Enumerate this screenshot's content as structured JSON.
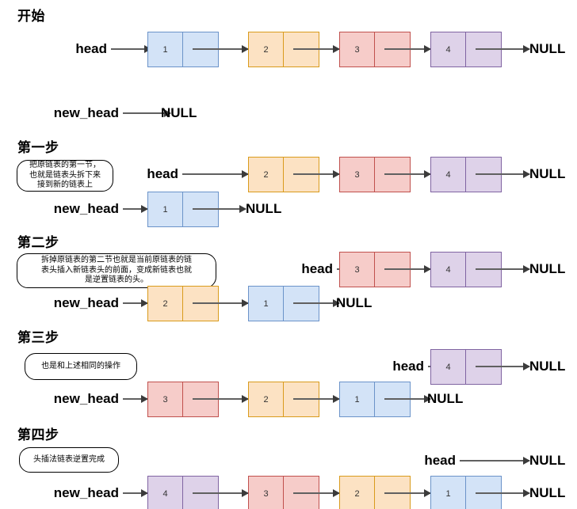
{
  "diagram": {
    "title_visible": false,
    "colors": {
      "blue_fill": "#d3e3f7",
      "blue_border": "#6b93c9",
      "orange_fill": "#fce2c3",
      "orange_border": "#d99b1c",
      "red_fill": "#f6ccc9",
      "red_border": "#c0504d",
      "purple_fill": "#ded2e9",
      "purple_border": "#8064a2",
      "arrow": "#606060"
    },
    "null_label": "NULL",
    "head_label": "head",
    "new_head_label": "new_head"
  },
  "sections": [
    {
      "heading": "开始",
      "note": null,
      "head_row": {
        "label": "head",
        "nodes": [
          "1",
          "2",
          "3",
          "4"
        ],
        "terminal": "NULL"
      },
      "new_head_row": {
        "label": "new_head",
        "nodes": [],
        "terminal": "NULL"
      }
    },
    {
      "heading": "第一步",
      "note": "把原链表的第一节，\n也就是链表头拆下来\n接到新的链表上",
      "head_row": {
        "label": "head",
        "nodes": [
          "2",
          "3",
          "4"
        ],
        "terminal": "NULL"
      },
      "new_head_row": {
        "label": "new_head",
        "nodes": [
          "1"
        ],
        "terminal": "NULL"
      }
    },
    {
      "heading": "第二步",
      "note": "拆掉原链表的第二节也就是当前原链表的链\n表头插入新链表头的前面，变成新链表也就\n是逆置链表的头。",
      "head_row": {
        "label": "head",
        "nodes": [
          "3",
          "4"
        ],
        "terminal": "NULL"
      },
      "new_head_row": {
        "label": "new_head",
        "nodes": [
          "2",
          "1"
        ],
        "terminal": "NULL"
      }
    },
    {
      "heading": "第三步",
      "note": "也是和上述相同的操作",
      "head_row": {
        "label": "head",
        "nodes": [
          "4"
        ],
        "terminal": "NULL"
      },
      "new_head_row": {
        "label": "new_head",
        "nodes": [
          "3",
          "2",
          "1"
        ],
        "terminal": "NULL"
      }
    },
    {
      "heading": "第四步",
      "note": "头插法链表逆置完成",
      "head_row": {
        "label": "head",
        "nodes": [],
        "terminal": "NULL"
      },
      "new_head_row": {
        "label": "new_head",
        "nodes": [
          "4",
          "3",
          "2",
          "1"
        ],
        "terminal": "NULL"
      }
    }
  ]
}
